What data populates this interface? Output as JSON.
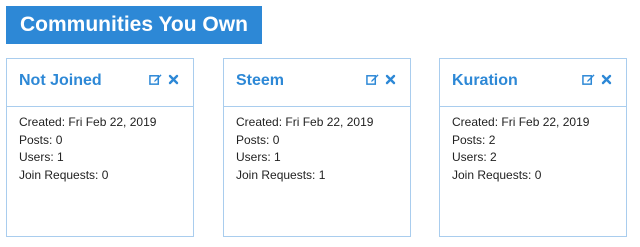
{
  "header": {
    "title": "Communities You Own"
  },
  "labels": {
    "created": "Created:",
    "posts": "Posts:",
    "users": "Users:",
    "join_requests": "Join Requests:"
  },
  "colors": {
    "accent": "#2d88d6",
    "border": "#a9cdee",
    "text": "#222222"
  },
  "icons": {
    "edit": "edit-icon",
    "delete": "close-icon"
  },
  "communities": [
    {
      "name": "Not Joined",
      "created": "Fri Feb 22, 2019",
      "posts": "0",
      "users": "1",
      "join_requests": "0"
    },
    {
      "name": "Steem",
      "created": "Fri Feb 22, 2019",
      "posts": "0",
      "users": "1",
      "join_requests": "1"
    },
    {
      "name": "Kuration",
      "created": "Fri Feb 22, 2019",
      "posts": "2",
      "users": "2",
      "join_requests": "0"
    }
  ]
}
